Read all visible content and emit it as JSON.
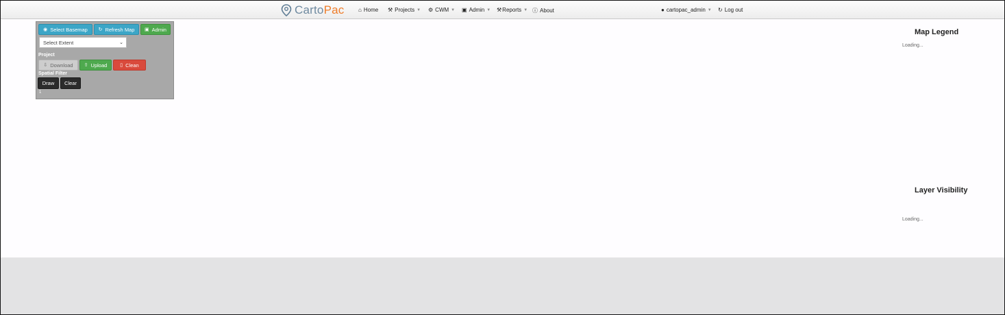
{
  "brand": {
    "part1": "Carto",
    "part2": "Pac"
  },
  "nav": {
    "home": "Home",
    "projects": "Projects",
    "cwm": "CWM",
    "admin": "Admin",
    "reports": "Reports",
    "about": "About",
    "user": "cartopac_admin",
    "logout": "Log out"
  },
  "panel": {
    "select_basemap": "Select Basemap",
    "refresh_map": "Refresh Map",
    "admin": "Admin",
    "select_extent": "Select Extent",
    "project_label": "Project",
    "download": "Download",
    "upload": "Upload",
    "clean": "Clean",
    "spatial_filter_label": "Spatial Filter",
    "draw": "Draw",
    "clear": "Clear",
    "tiny_text": "1"
  },
  "legend": {
    "map_legend_title": "Map Legend",
    "map_legend_status": "Loading...",
    "layer_visibility_title": "Layer Visibility",
    "layer_visibility_status": "Loading..."
  },
  "colors": {
    "brand_primary": "#6f8aa0",
    "brand_accent": "#ef7d2a",
    "btn_info": "#3ca6c7",
    "btn_success": "#4ea94e",
    "btn_danger": "#d94a3c",
    "btn_dark": "#2b2b2b"
  },
  "icons": {
    "brand": "map-pin-icon",
    "home": "home-icon",
    "projects": "wrench-icon",
    "cwm": "gear-icon",
    "admin": "briefcase-icon",
    "reports": "wrench-icon",
    "about": "info-circle-icon",
    "user": "user-icon",
    "logout": "refresh-icon",
    "basemap": "globe-icon",
    "refresh": "refresh-icon",
    "panel_admin": "briefcase-icon",
    "download": "download-icon",
    "upload": "upload-icon",
    "clean": "trash-icon"
  }
}
